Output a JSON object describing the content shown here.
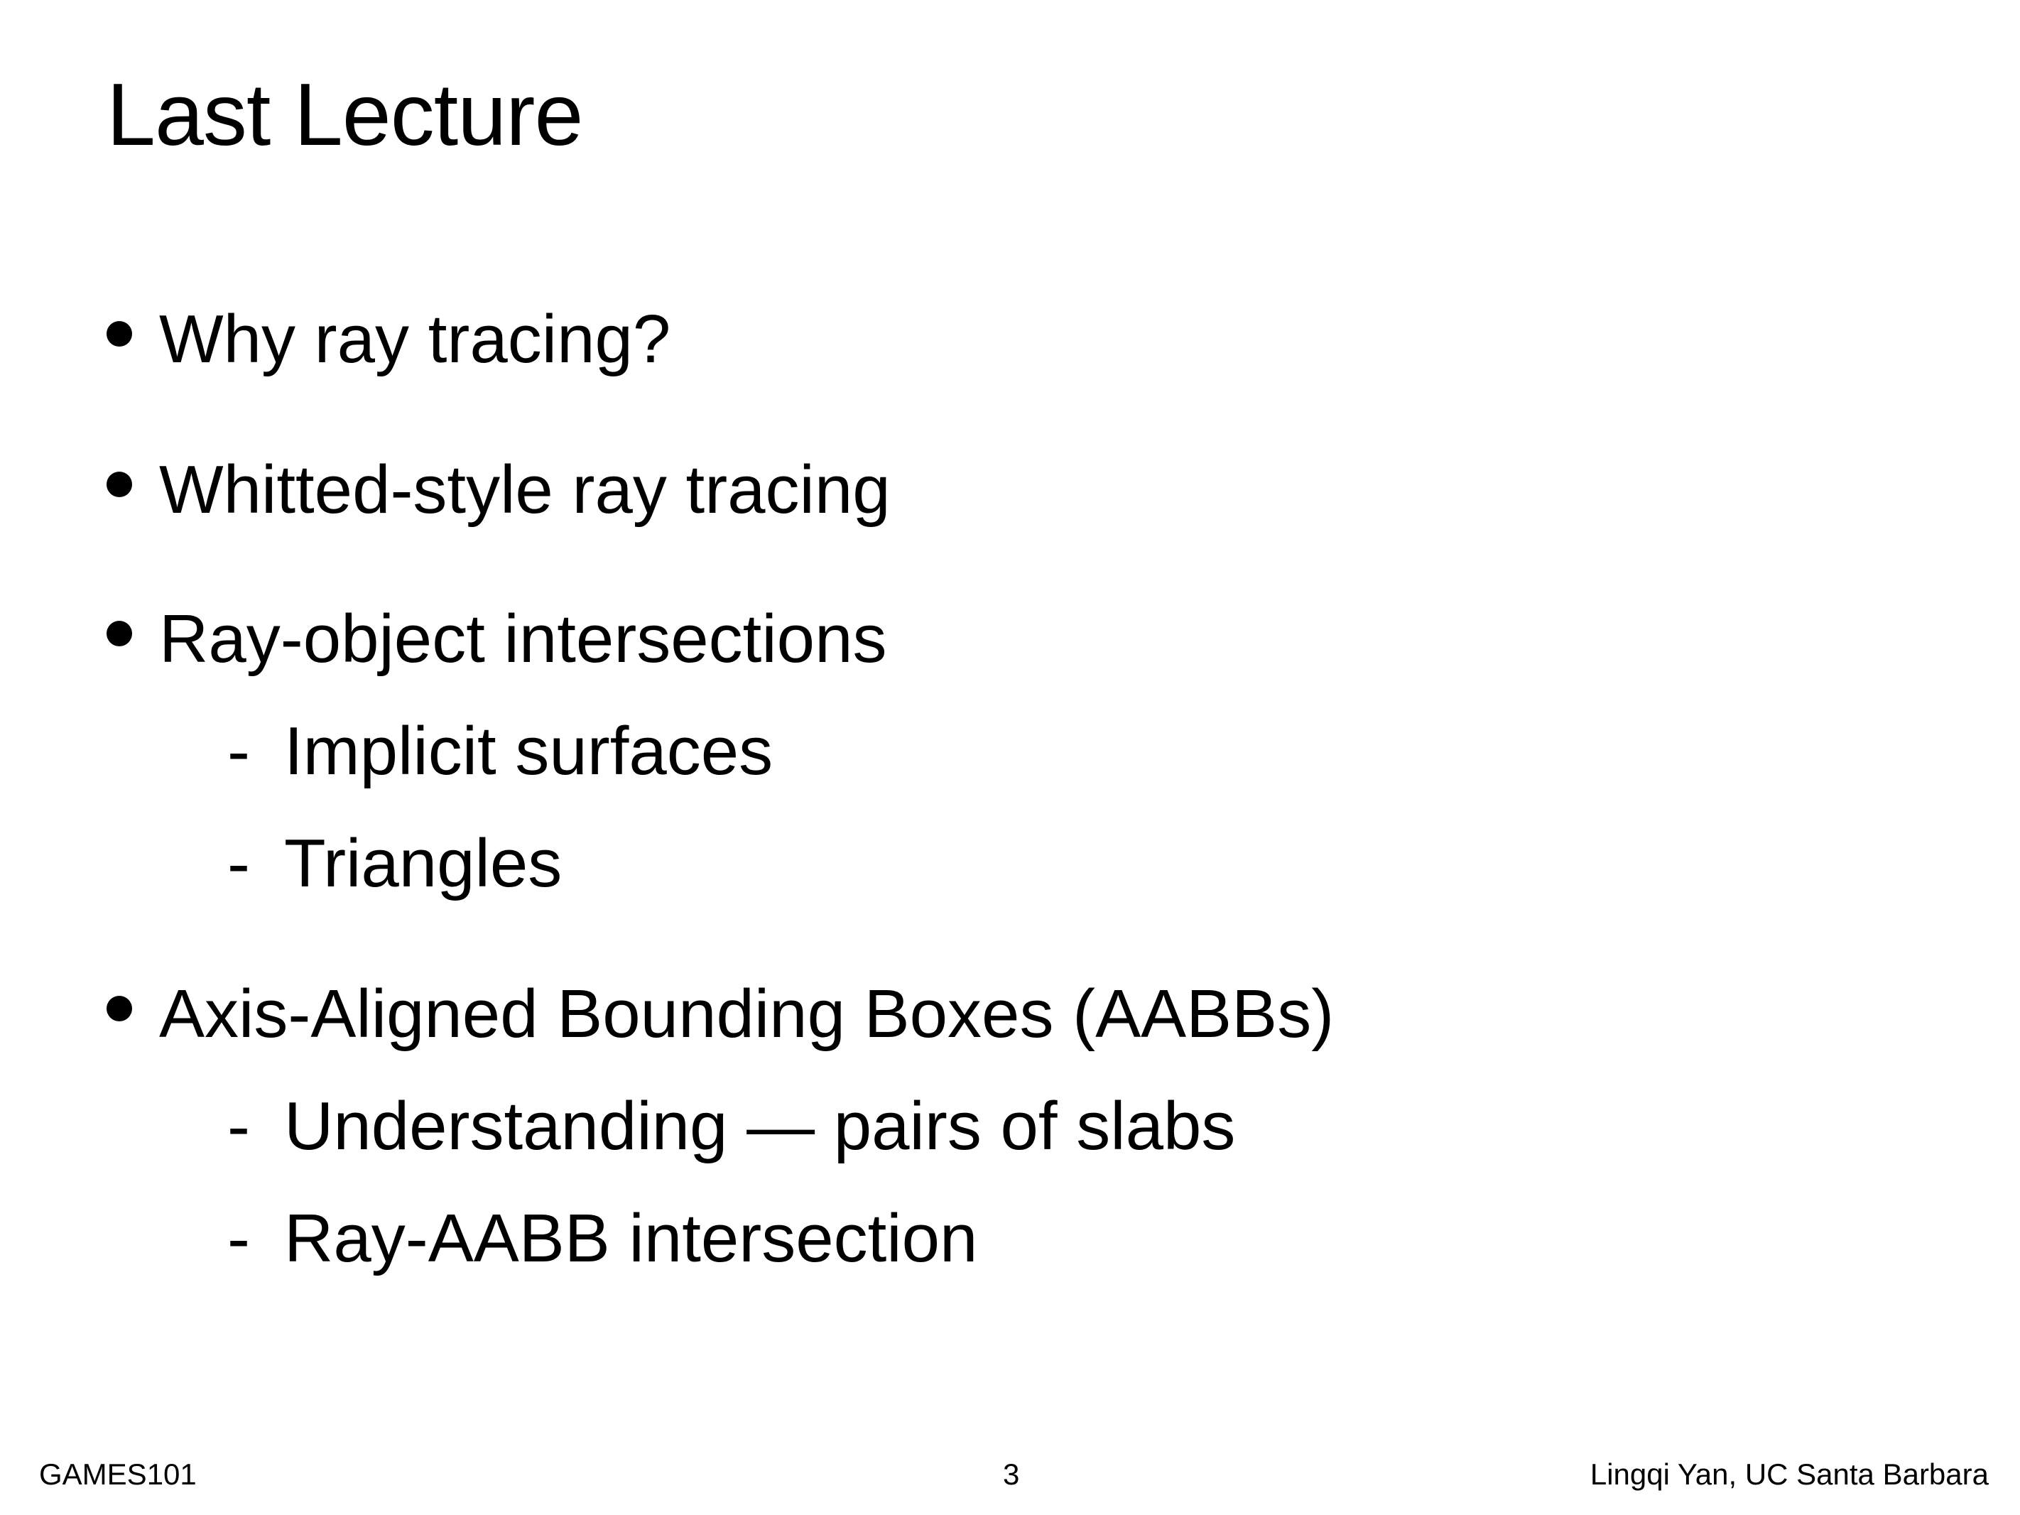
{
  "slide": {
    "title": "Last Lecture",
    "bullets": [
      {
        "text": "Why ray tracing?",
        "subitems": []
      },
      {
        "text": "Whitted-style ray tracing",
        "subitems": []
      },
      {
        "text": "Ray-object intersections",
        "subitems": [
          "Implicit surfaces",
          "Triangles"
        ]
      },
      {
        "text": "Axis-Aligned Bounding Boxes (AABBs)",
        "subitems": [
          "Understanding — pairs of slabs",
          "Ray-AABB intersection"
        ]
      }
    ],
    "sub_marker": "-"
  },
  "footer": {
    "left": "GAMES101",
    "page_number": "3",
    "right": "Lingqi Yan, UC Santa Barbara"
  }
}
